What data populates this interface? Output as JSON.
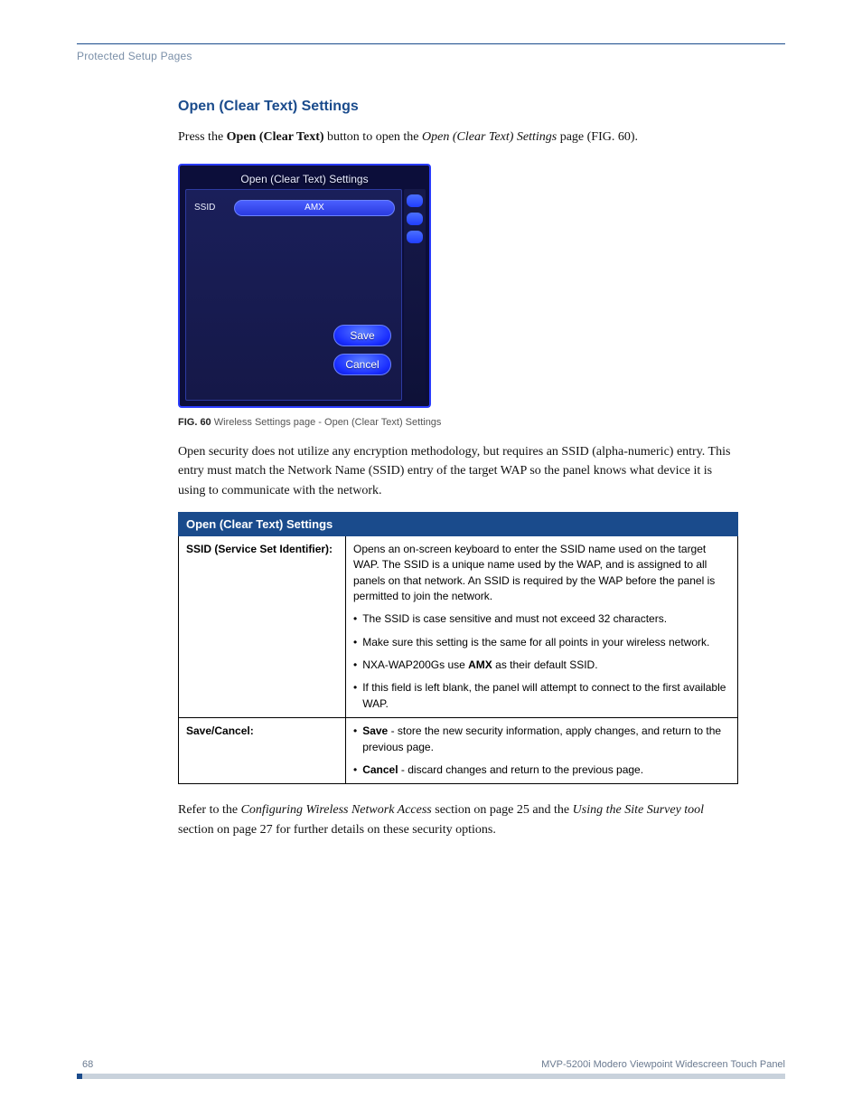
{
  "header": {
    "running_title": "Protected Setup Pages"
  },
  "section": {
    "heading": "Open (Clear Text) Settings",
    "intro_pre": "Press the ",
    "intro_bold": "Open (Clear Text)",
    "intro_mid": " button to open the ",
    "intro_ital": "Open (Clear Text) Settings",
    "intro_post": " page (FIG. 60)."
  },
  "figure": {
    "panel_title": "Open (Clear Text) Settings",
    "ssid_label": "SSID",
    "ssid_value": "AMX",
    "save_label": "Save",
    "cancel_label": "Cancel",
    "caption_bold": "FIG. 60",
    "caption_text": "  Wireless Settings page - Open (Clear Text) Settings"
  },
  "para_after_fig": "Open security does not utilize any encryption methodology, but requires an SSID (alpha-numeric) entry. This entry must match the Network Name (SSID) entry of the target WAP so the panel knows what device it is using to communicate with the network.",
  "table": {
    "title": "Open (Clear Text) Settings",
    "rows": [
      {
        "label": "SSID (Service Set Identifier):",
        "intro": "Opens an on-screen keyboard to enter the SSID name used on the target WAP. The SSID is a unique name used by the WAP, and is assigned to all panels on that network. An SSID is required by the WAP before the panel is permitted to join the network.",
        "bullets": [
          {
            "pre": "The SSID is case sensitive and must not exceed 32 characters."
          },
          {
            "pre": "Make sure this setting is the same for all points in your wireless network."
          },
          {
            "pre": "NXA-WAP200Gs use ",
            "bold": "AMX",
            "post": " as their default SSID."
          },
          {
            "pre": "If this field is left blank, the panel will attempt to connect to the first available WAP."
          }
        ]
      },
      {
        "label": "Save/Cancel:",
        "bullets": [
          {
            "bold": "Save",
            "post": " - store the new security information, apply changes, and return to the previous page."
          },
          {
            "bold": "Cancel",
            "post": " - discard changes and return to the previous page."
          }
        ]
      }
    ]
  },
  "closing": {
    "pre": "Refer to the ",
    "ital1": "Configuring Wireless Network Access",
    "mid1": " section on page 25 and the ",
    "ital2": "Using the Site Survey tool",
    "post": " section on page 27 for further details on these security options."
  },
  "footer": {
    "page_number": "68",
    "doc_title": "MVP-5200i Modero Viewpoint Widescreen Touch Panel"
  }
}
